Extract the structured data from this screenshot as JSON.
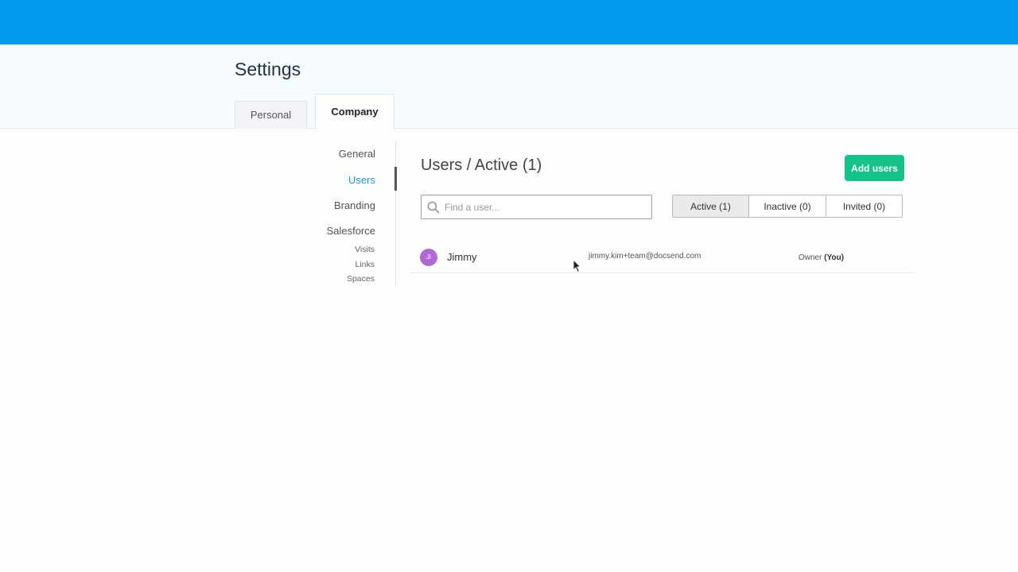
{
  "header": {
    "title": "Settings",
    "tabs": [
      {
        "label": "Personal",
        "active": false
      },
      {
        "label": "Company",
        "active": true
      }
    ]
  },
  "sidebar": {
    "items": [
      {
        "label": "General",
        "active": false
      },
      {
        "label": "Users",
        "active": true
      },
      {
        "label": "Branding",
        "active": false
      },
      {
        "label": "Salesforce",
        "active": false
      }
    ],
    "subitems": [
      "Visits",
      "Links",
      "Spaces"
    ]
  },
  "main": {
    "title": "Users / Active (1)",
    "add_button_label": "Add users",
    "search": {
      "placeholder": "Find a user...",
      "value": ""
    },
    "filters": [
      {
        "label": "Active (1)",
        "active": true
      },
      {
        "label": "Inactive (0)",
        "active": false
      },
      {
        "label": "Invited (0)",
        "active": false
      }
    ],
    "users": [
      {
        "initials": "Ji",
        "name": "Jimmy",
        "email": "jimmy.kim+team@docsend.com",
        "role": "Owner",
        "role_suffix": "(You)"
      }
    ]
  },
  "colors": {
    "topbar": "#0399ec",
    "accent": "#1a9ad6",
    "add_button": "#14c486",
    "avatar": "#b06ad6"
  }
}
